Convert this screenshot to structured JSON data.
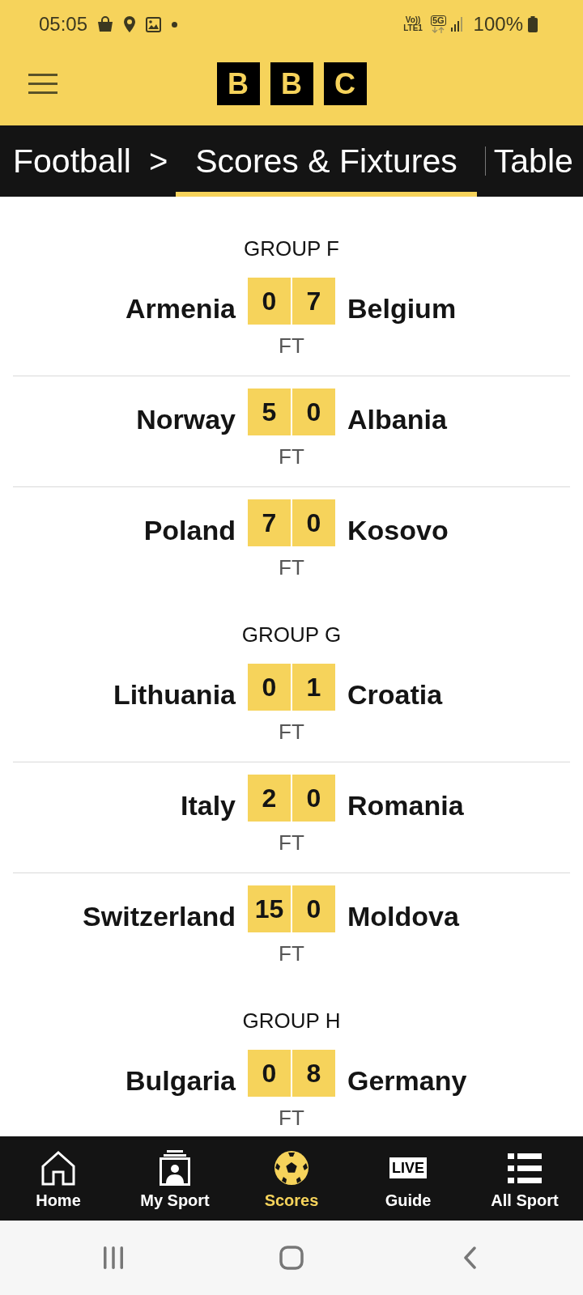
{
  "status_bar": {
    "time": "05:05",
    "volte": "Vo))",
    "lte": "LTE1",
    "network": "5G",
    "battery": "100%"
  },
  "header": {
    "logo_letters": [
      "B",
      "B",
      "C"
    ]
  },
  "nav_tabs": {
    "breadcrumb": "Football",
    "separator": ">",
    "tabs": [
      {
        "label": "Scores & Fixtures",
        "selected": true
      },
      {
        "label": "Table",
        "selected": false
      }
    ]
  },
  "groups": [
    {
      "name": "GROUP F",
      "matches": [
        {
          "home": "Armenia",
          "home_score": "0",
          "away_score": "7",
          "away": "Belgium",
          "status": "FT"
        },
        {
          "home": "Norway",
          "home_score": "5",
          "away_score": "0",
          "away": "Albania",
          "status": "FT"
        },
        {
          "home": "Poland",
          "home_score": "7",
          "away_score": "0",
          "away": "Kosovo",
          "status": "FT"
        }
      ]
    },
    {
      "name": "GROUP G",
      "matches": [
        {
          "home": "Lithuania",
          "home_score": "0",
          "away_score": "1",
          "away": "Croatia",
          "status": "FT"
        },
        {
          "home": "Italy",
          "home_score": "2",
          "away_score": "0",
          "away": "Romania",
          "status": "FT"
        },
        {
          "home": "Switzerland",
          "home_score": "15",
          "away_score": "0",
          "away": "Moldova",
          "status": "FT"
        }
      ]
    },
    {
      "name": "GROUP H",
      "matches": [
        {
          "home": "Bulgaria",
          "home_score": "0",
          "away_score": "8",
          "away": "Germany",
          "status": "FT"
        }
      ]
    }
  ],
  "bottom_nav": {
    "items": [
      {
        "kind": "home",
        "label": "Home",
        "selected": false
      },
      {
        "kind": "my_sport",
        "label": "My Sport",
        "selected": false
      },
      {
        "kind": "scores",
        "label": "Scores",
        "selected": true
      },
      {
        "kind": "guide",
        "label": "Guide",
        "icon_text": "LIVE",
        "selected": false
      },
      {
        "kind": "all_sport",
        "label": "All Sport",
        "selected": false
      }
    ]
  }
}
